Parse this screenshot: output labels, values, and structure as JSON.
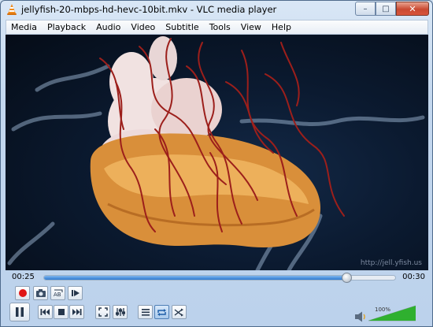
{
  "window": {
    "title": "jellyfish-20-mbps-hd-hevc-10bit.mkv - VLC media player",
    "controls": {
      "minimize": "–",
      "maximize": "□",
      "close": "✕"
    }
  },
  "menu": [
    "Media",
    "Playback",
    "Audio",
    "Video",
    "Subtitle",
    "Tools",
    "View",
    "Help"
  ],
  "video": {
    "watermark": "http://jell.yfish.us"
  },
  "seek": {
    "elapsed": "00:25",
    "total": "00:30",
    "progress": 0.86
  },
  "volume": {
    "label": "100%",
    "level": 1.0
  },
  "icons": {
    "record": "record-icon",
    "snapshot": "camera-icon",
    "loop_ab": "loop-ab-icon",
    "frame": "frame-step-icon",
    "play_pause": "pause-icon",
    "prev": "previous-icon",
    "stop": "stop-icon",
    "next": "next-icon",
    "fullscreen": "fullscreen-icon",
    "extended": "extended-settings-icon",
    "playlist": "playlist-icon",
    "loop": "loop-icon",
    "shuffle": "shuffle-icon",
    "speaker": "speaker-icon"
  },
  "colors": {
    "accent": "#2f7ad0",
    "record": "#e01515",
    "volume_fill": "#2fb02f"
  }
}
